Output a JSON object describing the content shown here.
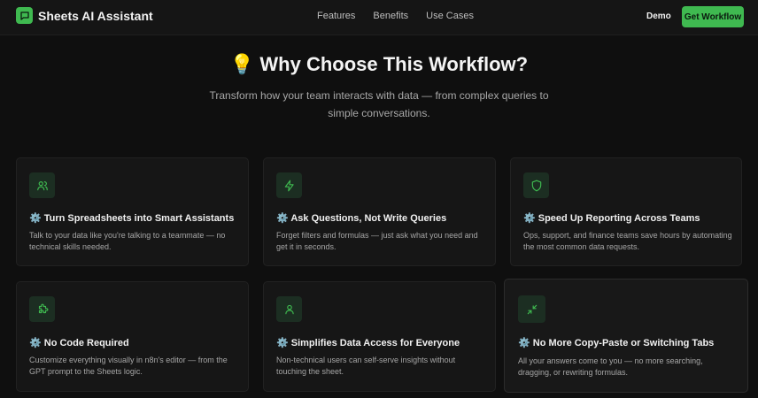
{
  "nav": {
    "brand": "Sheets AI Assistant",
    "links": [
      "Features",
      "Benefits",
      "Use Cases"
    ],
    "demo": "Demo",
    "cta": "Get Workflow"
  },
  "hero": {
    "title": "💡 Why Choose This Workflow?",
    "subtitle": "Transform how your team interacts with data — from complex queries to simple conversations."
  },
  "cards": [
    {
      "icon": "users-icon",
      "title": "⚙️ Turn Spreadsheets into Smart Assistants",
      "description": "Talk to your data like you're talking to a teammate — no technical skills needed."
    },
    {
      "icon": "lightning-icon",
      "title": "⚙️ Ask Questions, Not Write Queries",
      "description": "Forget filters and formulas — just ask what you need and get it in seconds."
    },
    {
      "icon": "shield-icon",
      "title": "⚙️ Speed Up Reporting Across Teams",
      "description": "Ops, support, and finance teams save hours by automating the most common data requests."
    },
    {
      "icon": "puzzle-icon",
      "title": "⚙️ No Code Required",
      "description": "Customize everything visually in n8n's editor — from the GPT prompt to the Sheets logic."
    },
    {
      "icon": "user-icon",
      "title": "⚙️ Simplifies Data Access for Everyone",
      "description": "Non-technical users can self-serve insights without touching the sheet."
    },
    {
      "icon": "minimize-arrows-icon",
      "title": "⚙️ No More Copy-Paste or Switching Tabs",
      "description": "All your answers come to you — no more searching, dragging, or rewriting formulas."
    }
  ],
  "colors": {
    "accent": "#3fb950",
    "background": "#0f0f0f",
    "card": "#161616"
  }
}
